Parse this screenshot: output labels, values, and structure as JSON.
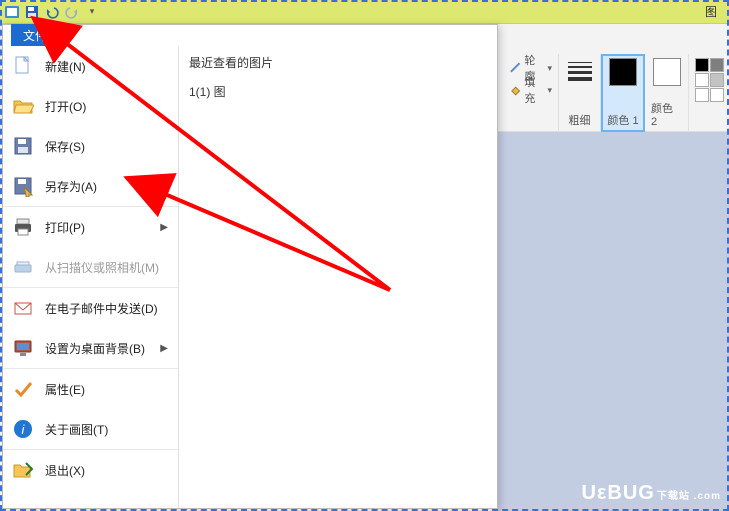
{
  "titlebar": {
    "right_text": "图"
  },
  "file_tab": "文件",
  "menu": {
    "new": "新建(N)",
    "open": "打开(O)",
    "save": "保存(S)",
    "saveas": "另存为(A)",
    "print": "打印(P)",
    "scanner": "从扫描仪或照相机(M)",
    "email": "在电子邮件中发送(D)",
    "wallpaper": "设置为桌面背景(B)",
    "properties": "属性(E)",
    "about": "关于画图(T)",
    "exit": "退出(X)"
  },
  "recent": {
    "heading": "最近查看的图片",
    "items": [
      "1(1) 图"
    ]
  },
  "ribbon": {
    "outline": "轮廓",
    "fill": "填充",
    "thickness": "粗细",
    "color1": "颜色 1",
    "color2": "颜色 2"
  },
  "colors": {
    "color1_value": "#000000",
    "color2_value": "#ffffff",
    "palette": [
      "#000000",
      "#7f7f7f",
      "#ffffff",
      "#c3c3c3",
      "#ffffff",
      "#ffffff"
    ]
  },
  "watermark": {
    "main": "UεBUG",
    "sub": "下载站 .com"
  }
}
